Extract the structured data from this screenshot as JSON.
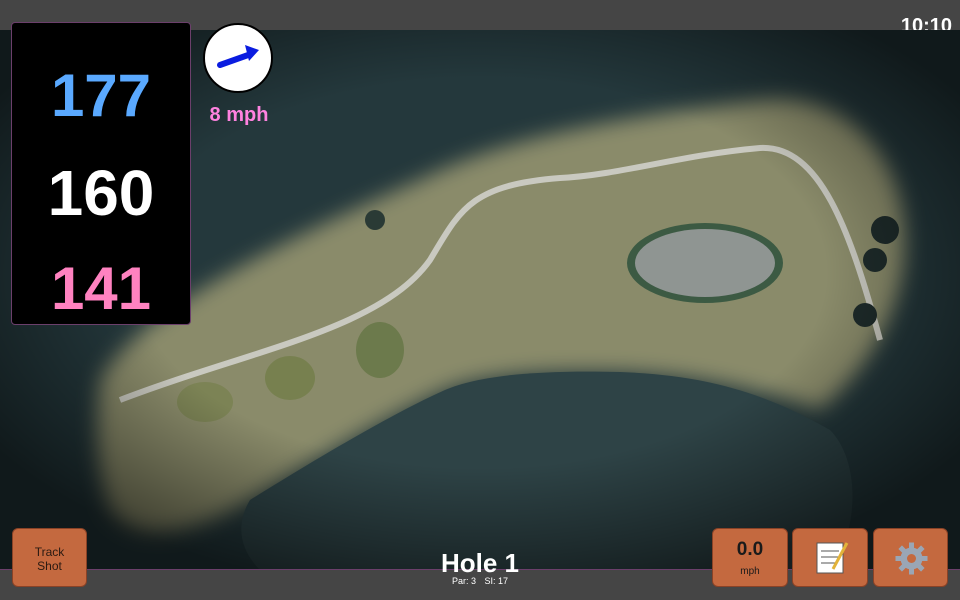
{
  "status_bar": {
    "time": "10:10"
  },
  "distances": {
    "back": "177",
    "middle": "160",
    "front": "141"
  },
  "wind": {
    "speed": "8 mph",
    "direction_icon": "wind-arrow-icon"
  },
  "hole": {
    "title": "Hole 1",
    "par": "Par: 3",
    "stroke_index": "SI: 17"
  },
  "buttons": {
    "track_shot": "Track\nShot",
    "speed_value": "0.0",
    "speed_unit": "mph",
    "notes_icon": "notepad-icon",
    "settings_icon": "gear-icon"
  },
  "colors": {
    "back_distance": "#5aa9ff",
    "middle_distance": "#ffffff",
    "front_distance": "#ff82c0",
    "wind_speed": "#ff82e0",
    "button": "#c4693f",
    "bar": "#454545"
  }
}
